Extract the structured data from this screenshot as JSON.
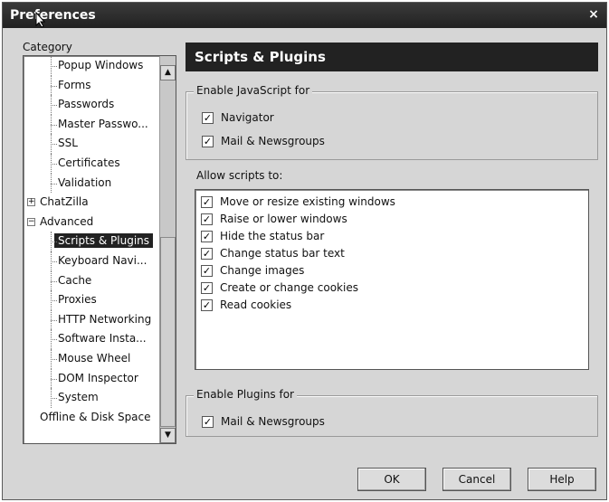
{
  "window": {
    "title": "Preferences",
    "close_glyph": "×"
  },
  "sidebar": {
    "category_label": "Category",
    "items": [
      {
        "label": "Popup Windows",
        "level": 1
      },
      {
        "label": "Forms",
        "level": 1
      },
      {
        "label": "Passwords",
        "level": 1
      },
      {
        "label": "Master Passwo...",
        "level": 1
      },
      {
        "label": "SSL",
        "level": 1
      },
      {
        "label": "Certificates",
        "level": 1
      },
      {
        "label": "Validation",
        "level": 1
      },
      {
        "label": "ChatZilla",
        "level": 0,
        "expander": "+"
      },
      {
        "label": "Advanced",
        "level": 0,
        "expander": "−"
      },
      {
        "label": "Scripts & Plugins",
        "level": 1,
        "selected": true
      },
      {
        "label": "Keyboard Navi...",
        "level": 1
      },
      {
        "label": "Cache",
        "level": 1
      },
      {
        "label": "Proxies",
        "level": 1
      },
      {
        "label": "HTTP Networking",
        "level": 1
      },
      {
        "label": "Software Insta...",
        "level": 1
      },
      {
        "label": "Mouse Wheel",
        "level": 1
      },
      {
        "label": "DOM Inspector",
        "level": 1
      },
      {
        "label": "System",
        "level": 1
      },
      {
        "label": "Offline & Disk Space",
        "level": 0
      }
    ]
  },
  "panel": {
    "title": "Scripts & Plugins",
    "enable_js": {
      "title": "Enable JavaScript for",
      "navigator": "Navigator",
      "mail_news": "Mail & Newsgroups"
    },
    "allow_scripts": {
      "title": "Allow scripts to:",
      "options": [
        "Move or resize existing windows",
        "Raise or lower windows",
        "Hide the status bar",
        "Change status bar text",
        "Change images",
        "Create or change cookies",
        "Read cookies"
      ]
    },
    "enable_plugins": {
      "title": "Enable Plugins for",
      "mail_news": "Mail & Newsgroups"
    }
  },
  "buttons": {
    "ok": "OK",
    "cancel": "Cancel",
    "help": "Help"
  },
  "check_glyph": "✓"
}
